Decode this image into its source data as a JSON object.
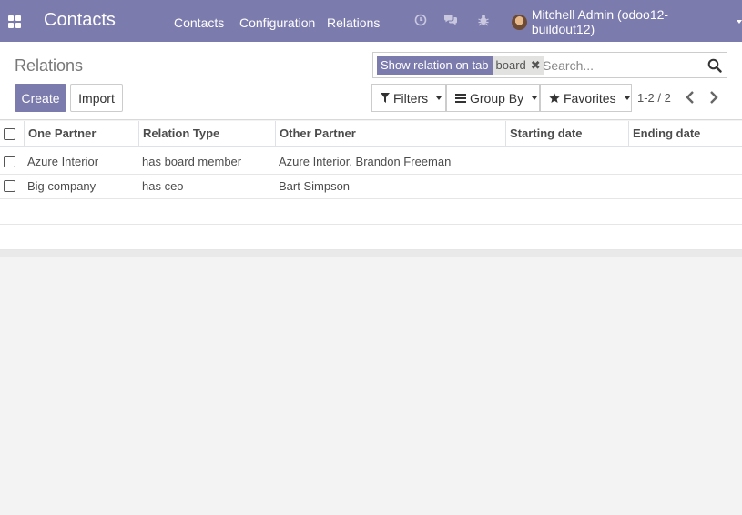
{
  "navbar": {
    "app_title": "Contacts",
    "menu": [
      "Contacts",
      "Configuration",
      "Relations"
    ],
    "icons": [
      "clock-icon",
      "chat-icon",
      "bug-icon"
    ],
    "user": "Mitchell Admin (odoo12-buildout12)"
  },
  "control": {
    "breadcrumb": "Relations",
    "create_label": "Create",
    "import_label": "Import",
    "search": {
      "facet_category": "Show relation on tab",
      "facet_value": "board",
      "placeholder": "Search..."
    },
    "filters_label": "Filters",
    "groupby_label": "Group By",
    "favorites_label": "Favorites",
    "pager": "1-2 / 2"
  },
  "table": {
    "columns": [
      "One Partner",
      "Relation Type",
      "Other Partner",
      "Starting date",
      "Ending date"
    ],
    "rows": [
      [
        "Azure Interior",
        "has board member",
        "Azure Interior, Brandon Freeman",
        "",
        ""
      ],
      [
        "Big company",
        "has ceo",
        "Bart Simpson",
        "",
        ""
      ]
    ]
  },
  "colors": {
    "brand": "#7c7bad",
    "facet_value_bg": "#e2e2e0",
    "background": "#f3f3f3"
  }
}
